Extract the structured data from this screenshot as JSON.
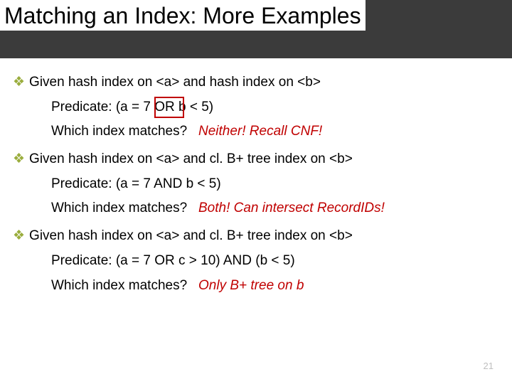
{
  "title": "Matching an Index: More Examples",
  "bullets": [
    {
      "head": "Given hash index on <a> and hash index on <b>",
      "predicate_label": "Predicate: (a = 7 OR b < 5)",
      "question": "Which index matches?",
      "answer": "Neither! Recall CNF!",
      "or_box": true
    },
    {
      "head": "Given hash index on <a> and cl. B+ tree index on <b>",
      "predicate_label": "Predicate: (a = 7 AND b < 5)",
      "question": "Which index matches?",
      "answer": "Both! Can intersect RecordIDs!",
      "or_box": false
    },
    {
      "head": "Given hash index on <a> and cl. B+ tree index on <b>",
      "predicate_label": "Predicate: (a = 7 OR c > 10) AND (b < 5)",
      "question": "Which index matches?",
      "answer": "Only B+ tree on b",
      "or_box": false
    }
  ],
  "page_number": "21",
  "bullet_glyph": "❖"
}
